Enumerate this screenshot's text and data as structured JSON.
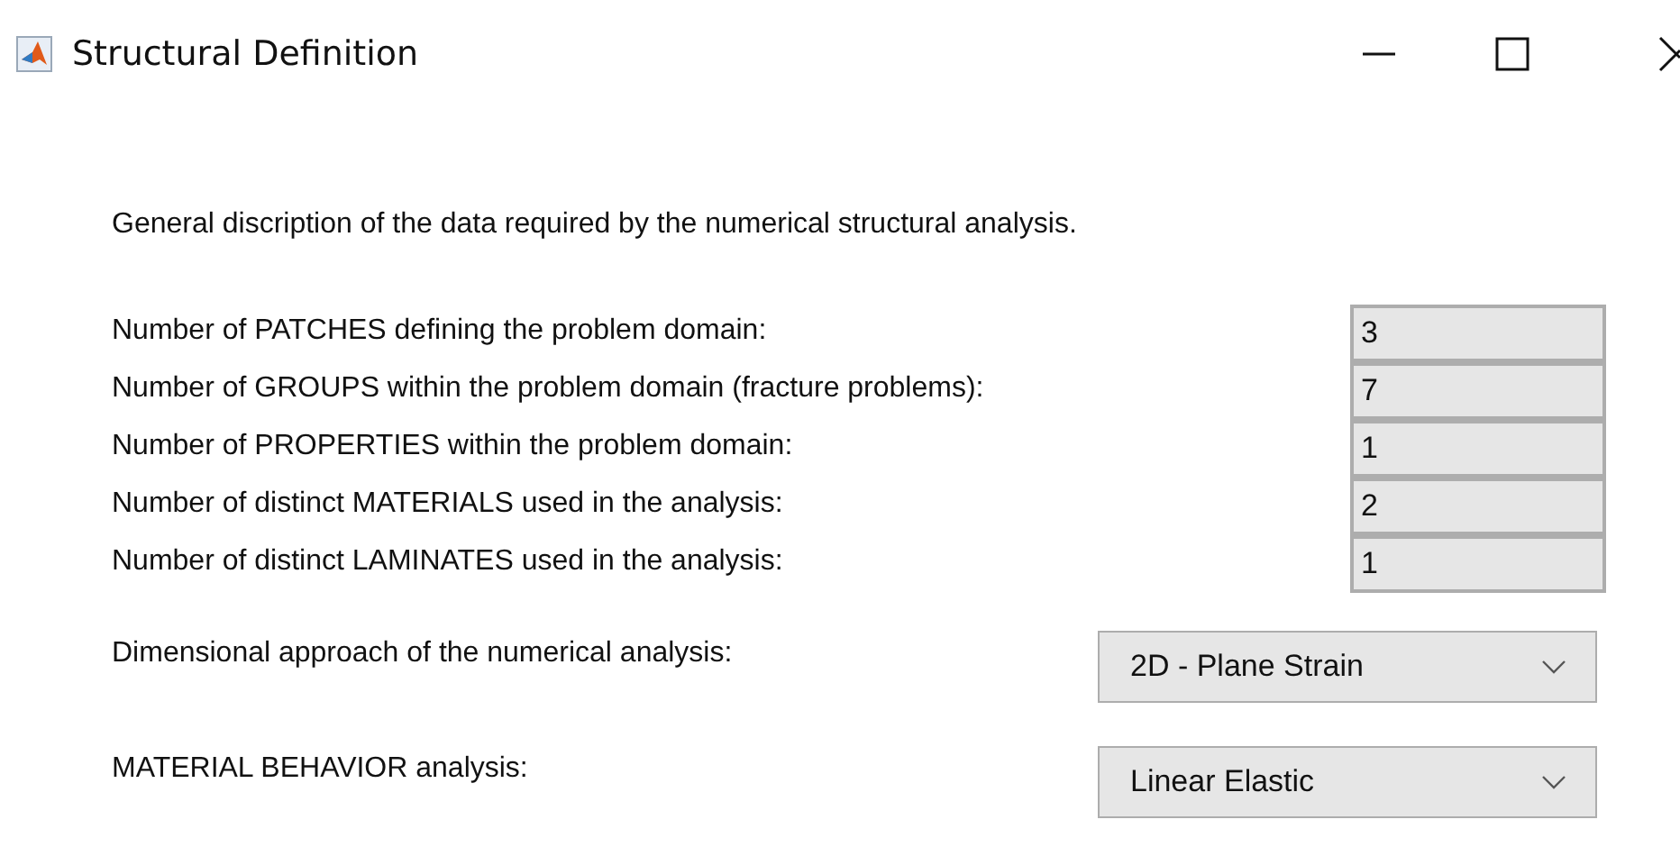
{
  "window": {
    "title": "Structural Definition"
  },
  "description": "General discription of the data required by the numerical structural analysis.",
  "fields": [
    {
      "label": "Number of PATCHES defining the problem domain:",
      "value": "3"
    },
    {
      "label": "Number of GROUPS within the problem domain (fracture problems):",
      "value": "7"
    },
    {
      "label": "Number of PROPERTIES within the problem domain:",
      "value": "1"
    },
    {
      "label": "Number of distinct MATERIALS used in the analysis:",
      "value": "2"
    },
    {
      "label": "Number of distinct LAMINATES used in the analysis:",
      "value": "1"
    }
  ],
  "dropdowns": [
    {
      "label": "Dimensional approach of the numerical analysis:",
      "value": "2D - Plane Strain"
    },
    {
      "label": "MATERIAL BEHAVIOR analysis:",
      "value": "Linear Elastic"
    }
  ]
}
